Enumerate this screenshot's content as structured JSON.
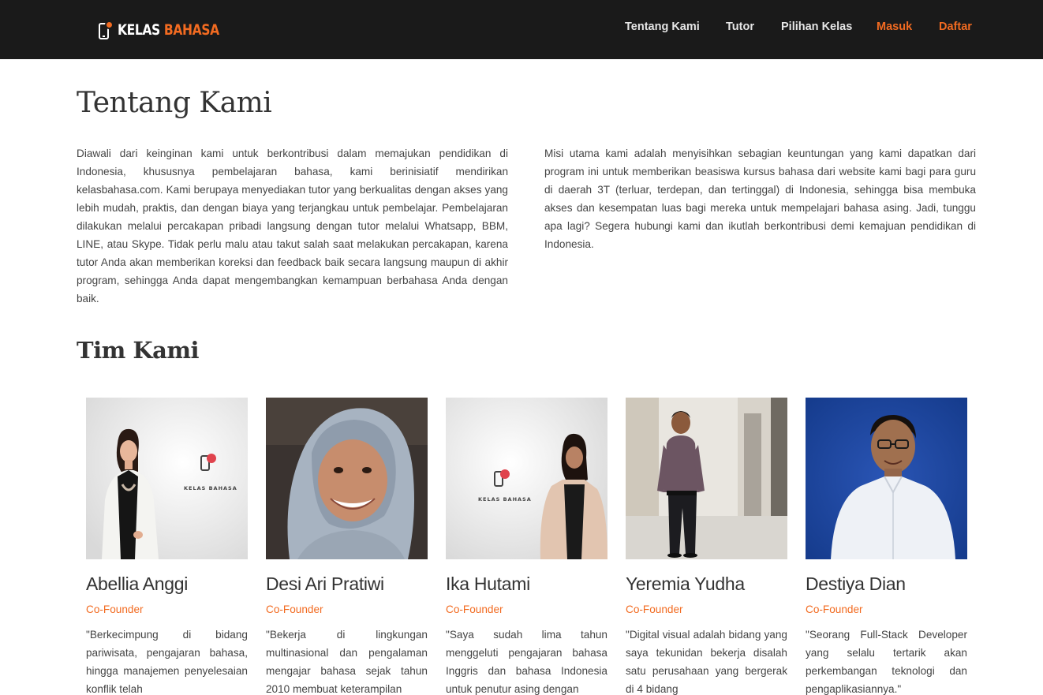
{
  "header": {
    "logo_word1": "KELAS",
    "logo_word2": "BAHASA",
    "nav": [
      {
        "label": "Tentang Kami"
      },
      {
        "label": "Tutor"
      },
      {
        "label": "Pilihan Kelas"
      },
      {
        "label": "Masuk"
      },
      {
        "label": "Daftar"
      }
    ]
  },
  "colors": {
    "accent": "#f26b21",
    "navbar_bg": "#1a1a1a",
    "text": "#333333"
  },
  "about": {
    "title": "Tentang Kami",
    "paragraph_left": "Diawali dari keinginan kami untuk berkontribusi dalam memajukan pendidikan di Indonesia, khususnya pembelajaran bahasa, kami berinisiatif mendirikan kelasbahasa.com. Kami berupaya menyediakan tutor yang berkualitas dengan akses yang lebih mudah, praktis, dan dengan biaya yang terjangkau untuk pembelajar. Pembelajaran dilakukan melalui percakapan pribadi langsung dengan tutor melalui Whatsapp, BBM, LINE, atau Skype. Tidak perlu malu atau takut salah saat melakukan percakapan, karena tutor Anda akan memberikan koreksi dan feedback baik secara langsung maupun di akhir program, sehingga Anda dapat mengembangkan kemampuan berbahasa Anda dengan baik.",
    "paragraph_right": "Misi utama kami adalah menyisihkan sebagian keuntungan yang kami dapatkan dari program ini untuk memberikan beasiswa kursus bahasa dari website kami bagi para guru di daerah 3T (terluar, terdepan, dan tertinggal) di Indonesia, sehingga bisa membuka akses dan kesempatan luas bagi mereka untuk mempelajari bahasa asing. Jadi, tunggu apa lagi? Segera hubungi kami dan ikutlah berkontribusi demi kemajuan pendidikan di Indonesia."
  },
  "team": {
    "title": "Tim Kami",
    "members": [
      {
        "name": "Abellia Anggi",
        "role": "Co-Founder",
        "quote": "\"Berkecimpung di bidang pariwisata, pengajaran bahasa, hingga manajemen penyelesaian konflik telah"
      },
      {
        "name": "Desi Ari Pratiwi",
        "role": "Co-Founder",
        "quote": "\"Bekerja di lingkungan multinasional dan pengalaman mengajar bahasa sejak tahun 2010 membuat keterampilan"
      },
      {
        "name": "Ika Hutami",
        "role": "Co-Founder",
        "quote": "\"Saya sudah lima tahun menggeluti pengajaran bahasa Inggris dan bahasa Indonesia untuk penutur asing dengan"
      },
      {
        "name": "Yeremia Yudha",
        "role": "Co-Founder",
        "quote": "\"Digital visual adalah bidang yang saya tekunidan bekerja disalah satu perusahaan yang bergerak di 4 bidang"
      },
      {
        "name": "Destiya Dian",
        "role": "Co-Founder",
        "quote": "\"Seorang Full-Stack Developer yang selalu tertarik akan perkembangan teknologi dan pengaplikasiannya.\""
      }
    ],
    "photo_logo_text": "KELAS BAHASA"
  }
}
